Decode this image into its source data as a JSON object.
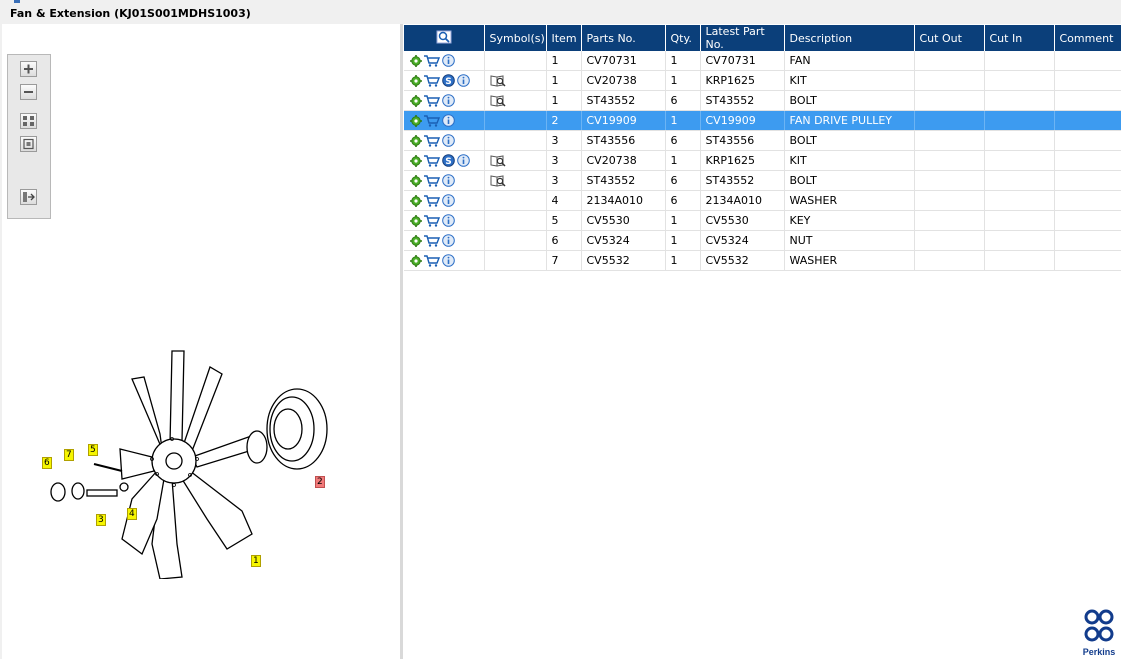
{
  "window": {
    "title": "Fan & Extension (KJ01S001MDHS1003)"
  },
  "viewer": {
    "tools": [
      {
        "name": "zoom-in-icon"
      },
      {
        "name": "zoom-out-icon"
      },
      {
        "name": "fit-page-icon"
      },
      {
        "name": "actual-size-icon"
      },
      {
        "name": "export-icon"
      }
    ],
    "callouts": [
      "1",
      "2",
      "3",
      "4",
      "5",
      "6",
      "7"
    ],
    "highlighted_callout": "2"
  },
  "table": {
    "columns": [
      "",
      "Symbol(s)",
      "Item",
      "Parts No.",
      "Qty.",
      "Latest Part No.",
      "Description",
      "Cut Out",
      "Cut In",
      "Comment"
    ],
    "rows": [
      {
        "s": false,
        "book": false,
        "item": "1",
        "part": "CV70731",
        "qty": "1",
        "latest": "CV70731",
        "desc": "FAN",
        "cutout": "",
        "cutin": "",
        "comment": "",
        "selected": false
      },
      {
        "s": true,
        "book": true,
        "item": "1",
        "part": "CV20738",
        "qty": "1",
        "latest": "KRP1625",
        "desc": "KIT",
        "cutout": "",
        "cutin": "",
        "comment": "",
        "selected": false
      },
      {
        "s": false,
        "book": true,
        "item": "1",
        "part": "ST43552",
        "qty": "6",
        "latest": "ST43552",
        "desc": "BOLT",
        "cutout": "",
        "cutin": "",
        "comment": "",
        "selected": false
      },
      {
        "s": false,
        "book": false,
        "item": "2",
        "part": "CV19909",
        "qty": "1",
        "latest": "CV19909",
        "desc": "FAN DRIVE PULLEY",
        "cutout": "",
        "cutin": "",
        "comment": "",
        "selected": true
      },
      {
        "s": false,
        "book": false,
        "item": "3",
        "part": "ST43556",
        "qty": "6",
        "latest": "ST43556",
        "desc": "BOLT",
        "cutout": "",
        "cutin": "",
        "comment": "",
        "selected": false
      },
      {
        "s": true,
        "book": true,
        "item": "3",
        "part": "CV20738",
        "qty": "1",
        "latest": "KRP1625",
        "desc": "KIT",
        "cutout": "",
        "cutin": "",
        "comment": "",
        "selected": false
      },
      {
        "s": false,
        "book": true,
        "item": "3",
        "part": "ST43552",
        "qty": "6",
        "latest": "ST43552",
        "desc": "BOLT",
        "cutout": "",
        "cutin": "",
        "comment": "",
        "selected": false
      },
      {
        "s": false,
        "book": false,
        "item": "4",
        "part": "2134A010",
        "qty": "6",
        "latest": "2134A010",
        "desc": "WASHER",
        "cutout": "",
        "cutin": "",
        "comment": "",
        "selected": false
      },
      {
        "s": false,
        "book": false,
        "item": "5",
        "part": "CV5530",
        "qty": "1",
        "latest": "CV5530",
        "desc": "KEY",
        "cutout": "",
        "cutin": "",
        "comment": "",
        "selected": false
      },
      {
        "s": false,
        "book": false,
        "item": "6",
        "part": "CV5324",
        "qty": "1",
        "latest": "CV5324",
        "desc": "NUT",
        "cutout": "",
        "cutin": "",
        "comment": "",
        "selected": false
      },
      {
        "s": false,
        "book": false,
        "item": "7",
        "part": "CV5532",
        "qty": "1",
        "latest": "CV5532",
        "desc": "WASHER",
        "cutout": "",
        "cutin": "",
        "comment": "",
        "selected": false
      }
    ]
  },
  "brand": {
    "name": "Perkins",
    "color": "#123c8c"
  },
  "colors": {
    "header": "#0b3f7a",
    "selection": "#3d9bf0"
  }
}
